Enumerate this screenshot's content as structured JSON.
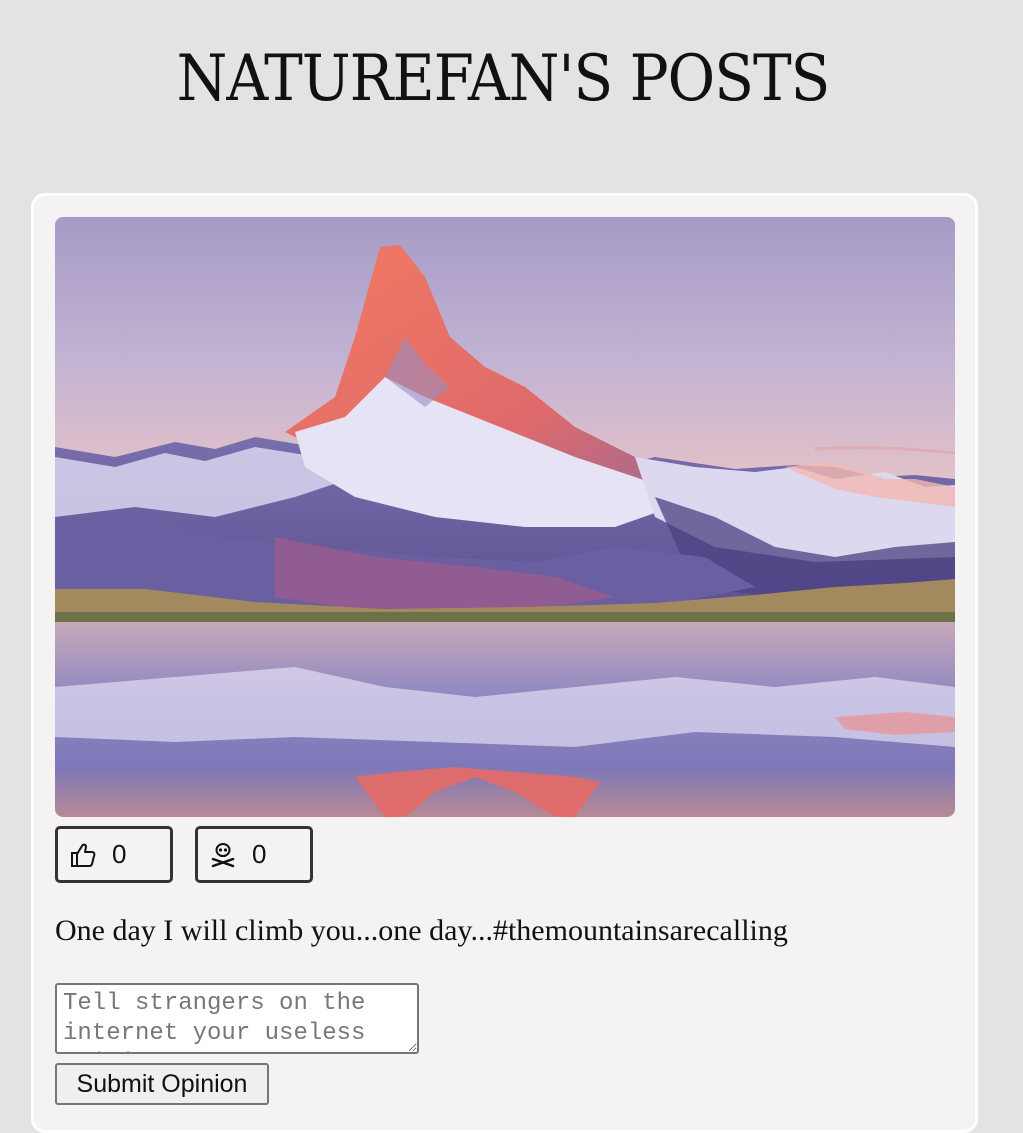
{
  "header": {
    "title": "NATUREFAN'S POSTS"
  },
  "post": {
    "image_icon": "mountain-lake-photo",
    "reactions": {
      "like": {
        "icon": "thumbs-up-icon",
        "count": "0"
      },
      "dislike": {
        "icon": "skull-crossbones-icon",
        "count": "0"
      }
    },
    "caption": "One day I will climb you...one day...#themountainsarecalling",
    "comment": {
      "value": "",
      "placeholder": "Tell strangers on the internet your useless opinion"
    },
    "submit_label": "Submit Opinion"
  },
  "colors": {
    "page_background": "#e3e3e3",
    "card_background": "#f4f2f3",
    "button_border": "#333333"
  }
}
